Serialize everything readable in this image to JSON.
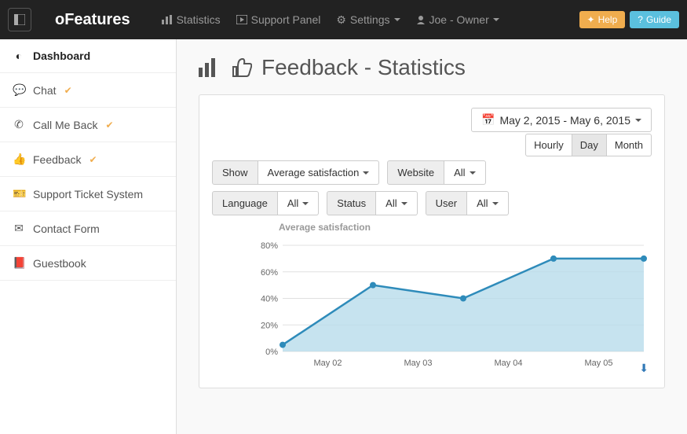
{
  "brand": "oFeatures",
  "topnav": {
    "statistics": "Statistics",
    "support_panel": "Support Panel",
    "settings": "Settings",
    "user": "Joe - Owner"
  },
  "buttons": {
    "help": "Help",
    "guide": "Guide"
  },
  "sidebar": {
    "items": [
      {
        "label": "Dashboard",
        "active": true
      },
      {
        "label": "Chat",
        "warn": true
      },
      {
        "label": "Call Me Back",
        "warn": true
      },
      {
        "label": "Feedback",
        "warn": true
      },
      {
        "label": "Support Ticket System"
      },
      {
        "label": "Contact Form"
      },
      {
        "label": "Guestbook"
      }
    ]
  },
  "page": {
    "title": "Feedback - Statistics"
  },
  "daterange": "May 2, 2015 - May 6, 2015",
  "period": {
    "hourly": "Hourly",
    "day": "Day",
    "month": "Month",
    "active": "Day"
  },
  "filters": {
    "show_label": "Show",
    "show_value": "Average satisfaction",
    "website_label": "Website",
    "website_value": "All",
    "language_label": "Language",
    "language_value": "All",
    "status_label": "Status",
    "status_value": "All",
    "user_label": "User",
    "user_value": "All"
  },
  "chart_data": {
    "type": "area",
    "title": "Average satisfaction",
    "xlabel": "",
    "ylabel": "",
    "ylim": [
      0,
      80
    ],
    "y_ticks": [
      0,
      20,
      40,
      60,
      80
    ],
    "y_tick_labels": [
      "0%",
      "20%",
      "40%",
      "60%",
      "80%"
    ],
    "categories": [
      "May 02",
      "May 03",
      "May 04",
      "May 05"
    ],
    "series": [
      {
        "name": "Average satisfaction",
        "values_pct": [
          5,
          50,
          40,
          70,
          70
        ]
      }
    ]
  }
}
